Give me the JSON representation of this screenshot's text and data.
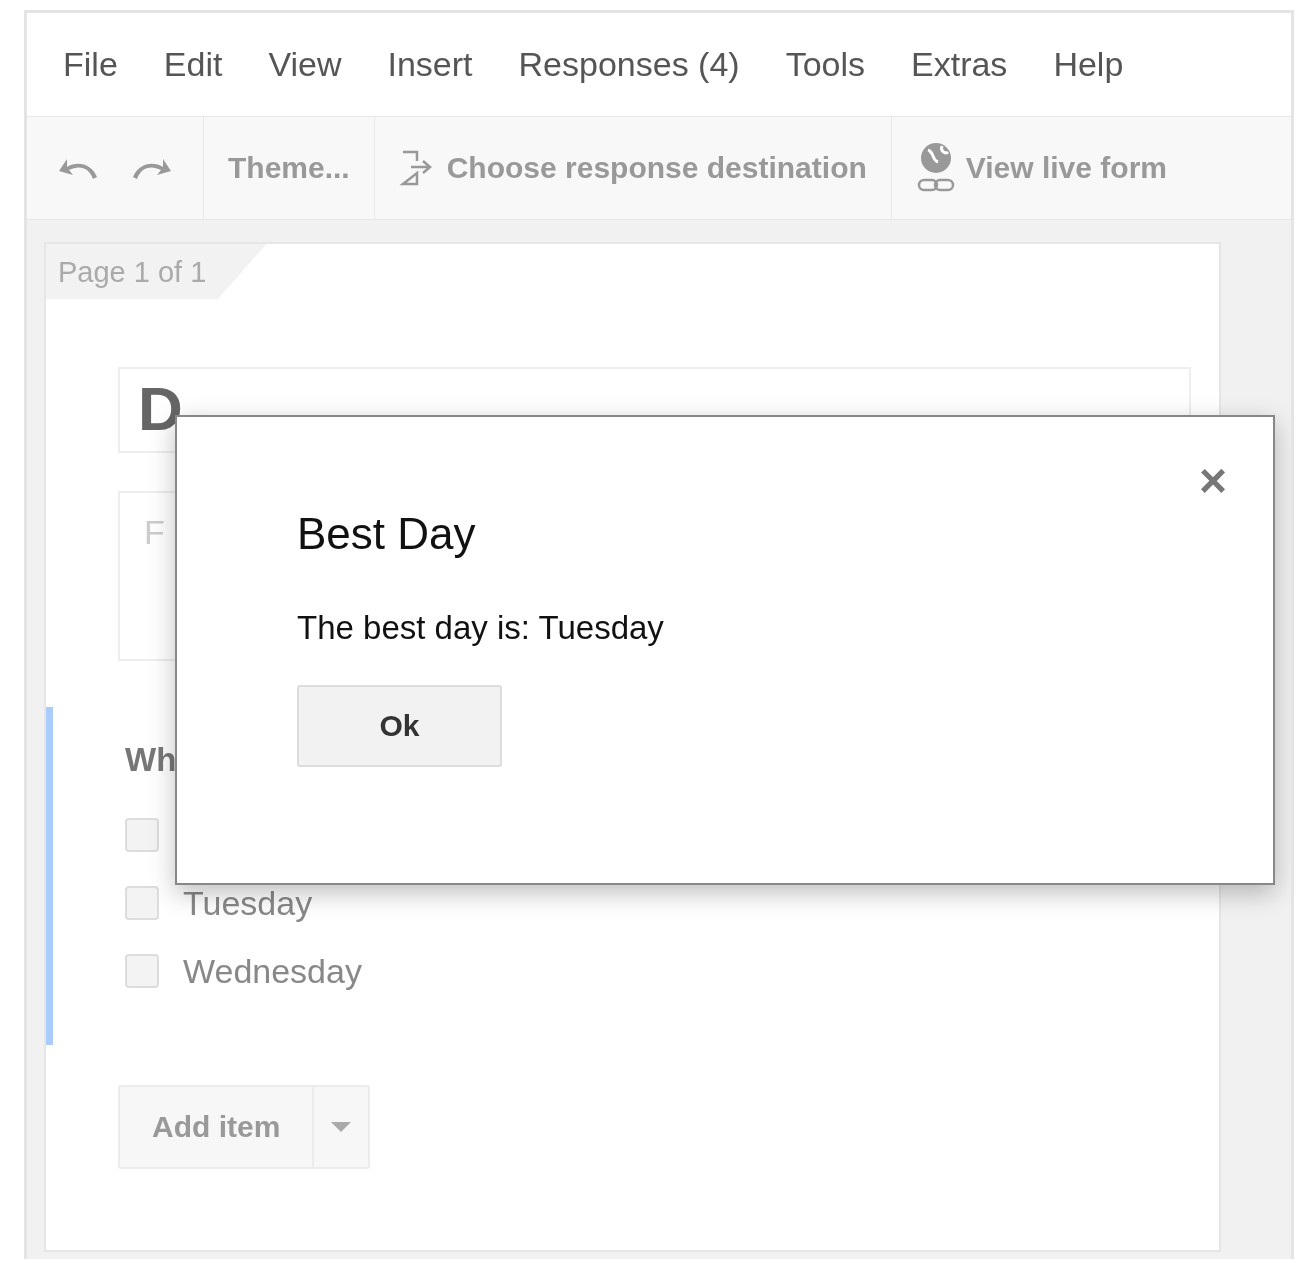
{
  "menu": [
    "File",
    "Edit",
    "View",
    "Insert",
    "Responses (4)",
    "Tools",
    "Extras",
    "Help"
  ],
  "toolbar": {
    "theme": "Theme...",
    "destination": "Choose response destination",
    "live": "View live form"
  },
  "page_label": "Page 1 of 1",
  "form": {
    "title": "D",
    "description_placeholder": "F",
    "question": "Wh",
    "options": [
      {
        "checked": false
      },
      {
        "label": "Tuesday",
        "checked": false
      },
      {
        "label": "Wednesday",
        "checked": false
      }
    ],
    "add_item": "Add item"
  },
  "dialog": {
    "close": "×",
    "title": "Best Day",
    "message": "The best day is: Tuesday",
    "ok": "Ok"
  }
}
